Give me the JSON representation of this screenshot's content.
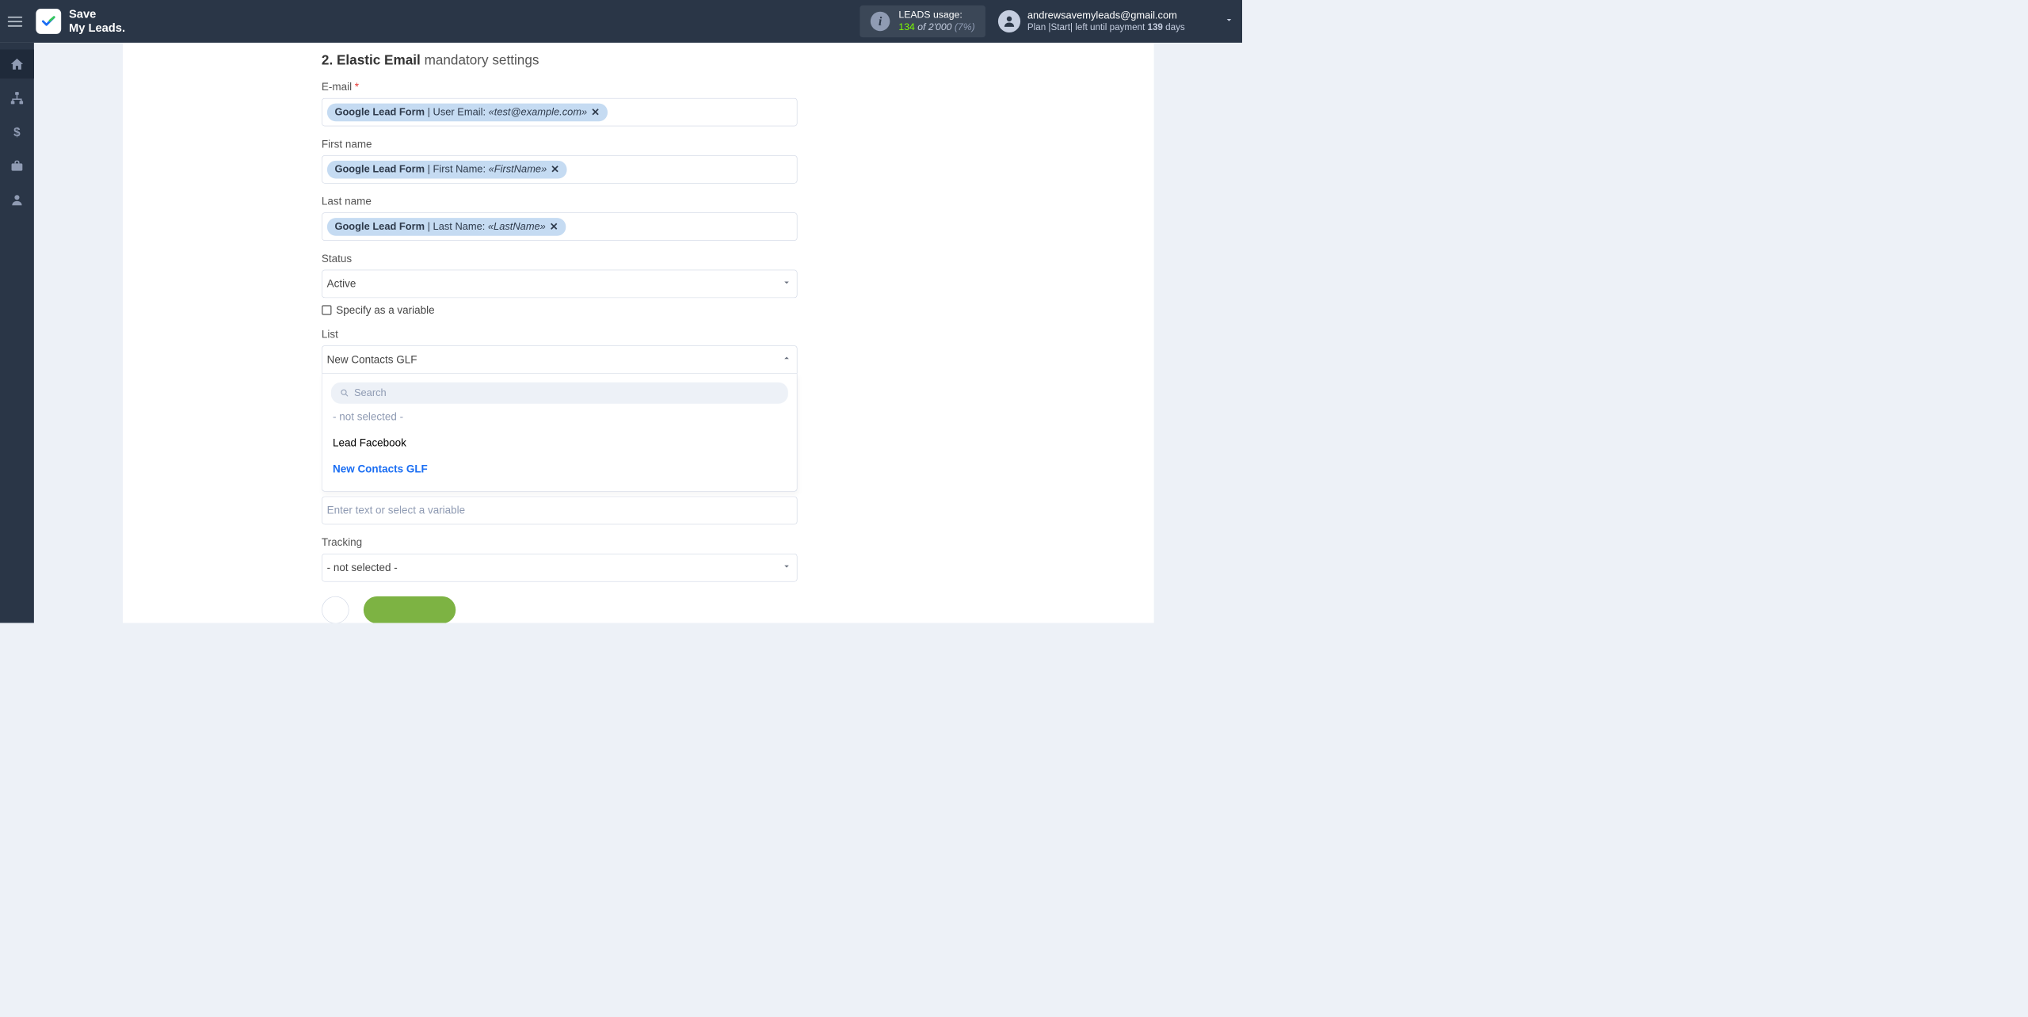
{
  "header": {
    "logo_line1": "Save",
    "logo_line2": "My Leads.",
    "usage_label": "LEADS usage:",
    "usage_count": "134",
    "usage_of": "of",
    "usage_total": "2'000",
    "usage_pct": "(7%)",
    "user_email": "andrewsavemyleads@gmail.com",
    "plan_prefix": "Plan |",
    "plan_name": "Start",
    "plan_mid": "| left until payment ",
    "plan_days_num": "139",
    "plan_days_word": " days"
  },
  "section": {
    "step": "2.",
    "title_bold": "Elastic Email",
    "title_light": " mandatory settings"
  },
  "fields": {
    "email": {
      "label": "E-mail",
      "chip_source": "Google Lead Form",
      "chip_sep": " | ",
      "chip_field": "User Email: ",
      "chip_sample": "«test@example.com»"
    },
    "first_name": {
      "label": "First name",
      "chip_source": "Google Lead Form",
      "chip_sep": " | ",
      "chip_field": "First Name: ",
      "chip_sample": "«FirstName»"
    },
    "last_name": {
      "label": "Last name",
      "chip_source": "Google Lead Form",
      "chip_sep": " | ",
      "chip_field": "Last Name: ",
      "chip_sample": "«LastName»"
    },
    "status": {
      "label": "Status",
      "value": "Active",
      "specify": "Specify as a variable"
    },
    "list": {
      "label": "List",
      "value": "New Contacts GLF",
      "search_placeholder": "Search",
      "options": [
        "- not selected -",
        "Lead Facebook",
        "New Contacts GLF"
      ]
    },
    "extra": {
      "placeholder": "Enter text or select a variable"
    },
    "tracking": {
      "label": "Tracking",
      "value": "- not selected -"
    }
  }
}
